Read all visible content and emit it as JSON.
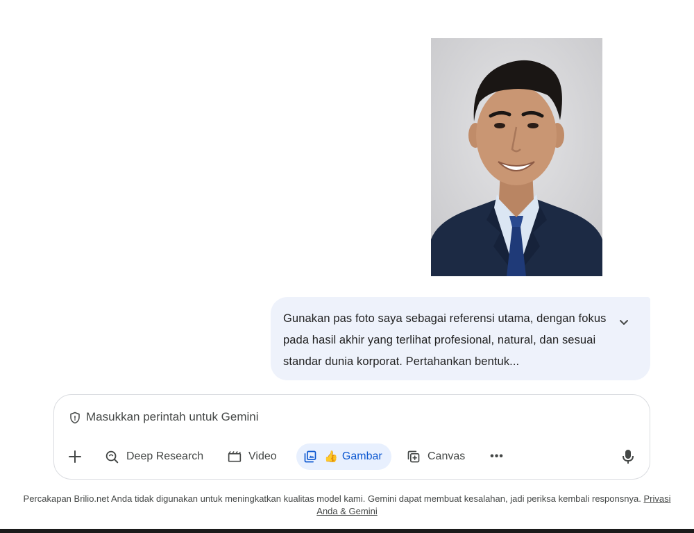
{
  "conversation": {
    "attached_image": {
      "alt": "Pas foto",
      "background_color": "#d9d9db",
      "suit_color": "#1c2a44",
      "shirt_color": "#dbe6f3",
      "tie_color": "#1f3a78"
    },
    "user_message": {
      "text": "Gunakan pas foto saya sebagai referensi utama, dengan fokus pada hasil akhir yang terlihat profesional, natural, dan sesuai standar dunia korporat. Pertahankan bentuk...",
      "expand_icon": "chevron-down-icon",
      "bubble_color": "#eef2fb"
    }
  },
  "composer": {
    "shield_icon": "shield-icon",
    "placeholder": "Masukkan perintah untuk Gemini",
    "tools": {
      "add_icon": "plus-icon",
      "deep_research": "Deep Research",
      "video": "Video",
      "gambar": "Gambar",
      "gambar_sparkle": "👍",
      "canvas": "Canvas",
      "more": "•••",
      "mic_icon": "microphone-icon"
    },
    "active_color": "#0b57d0",
    "active_bg": "#e8f0fe"
  },
  "footer": {
    "text": "Percakapan Brilio.net Anda tidak digunakan untuk meningkatkan kualitas model kami. Gemini dapat membuat kesalahan, jadi periksa kembali responsnya.",
    "link": "Privasi Anda & Gemini"
  }
}
